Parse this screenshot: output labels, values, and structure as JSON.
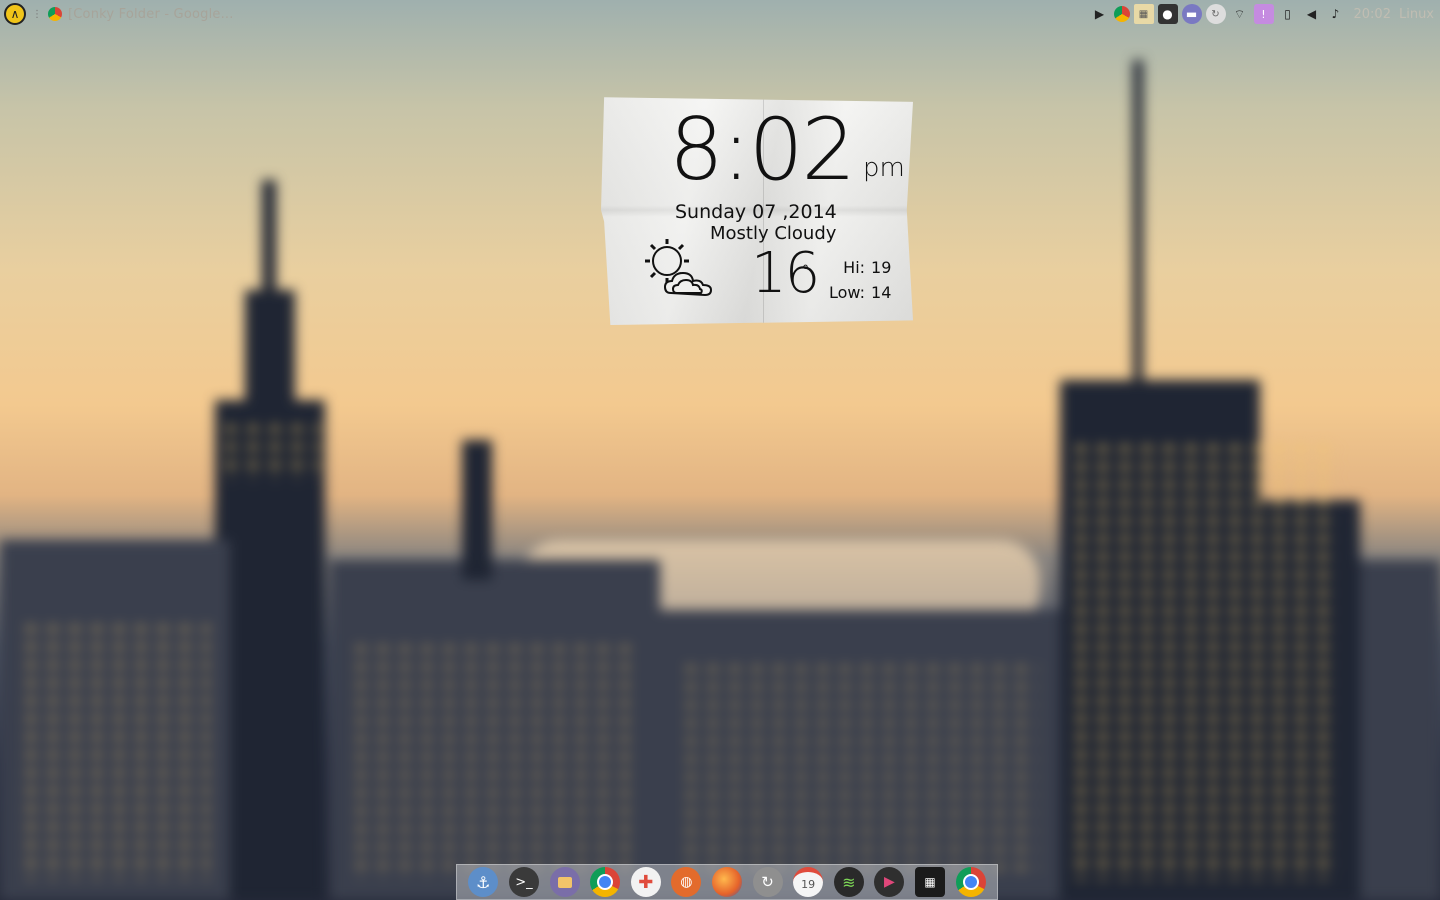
{
  "top_panel": {
    "window_title": "[Conky Folder - Google...",
    "clock": "20:02",
    "distro": "Linux",
    "tray_icons": [
      "audio-player-icon",
      "chrome-icon",
      "photo-icon",
      "circle-app-icon",
      "chat-icon",
      "update-icon",
      "wifi-icon",
      "indicator-icon",
      "battery-icon",
      "volume-icon",
      "bell-icon"
    ]
  },
  "conky": {
    "time": "8:02",
    "ampm": "pm",
    "date": "Sunday 07 ,2014",
    "condition": "Mostly Cloudy",
    "temperature": "16",
    "degree_symbol": "°",
    "hi_label": "Hi:",
    "hi_value": "19",
    "low_label": "Low:",
    "low_value": "14"
  },
  "dock": {
    "items": [
      {
        "name": "anchor-icon",
        "color": "#5d8ec9"
      },
      {
        "name": "terminal-icon",
        "color": "#3a3a3a"
      },
      {
        "name": "files-icon",
        "color": "#7a6ea8"
      },
      {
        "name": "chrome-icon",
        "color": "#e8e8e8"
      },
      {
        "name": "plus-app-icon",
        "color": "#f2f2f2"
      },
      {
        "name": "basketball-icon",
        "color": "#e36b2c"
      },
      {
        "name": "firefox-icon",
        "color": "#e5622a"
      },
      {
        "name": "sync-icon",
        "color": "#8f8f8f"
      },
      {
        "name": "calendar-icon",
        "color": "#f5f5f5"
      },
      {
        "name": "spotify-icon",
        "color": "#2a2a2a"
      },
      {
        "name": "media-player-icon",
        "color": "#2f2f2f"
      },
      {
        "name": "apps-grid-icon",
        "color": "#1b1b1b"
      },
      {
        "name": "chrome-icon",
        "color": "#e8e8e8"
      }
    ],
    "calendar_day": "19"
  }
}
